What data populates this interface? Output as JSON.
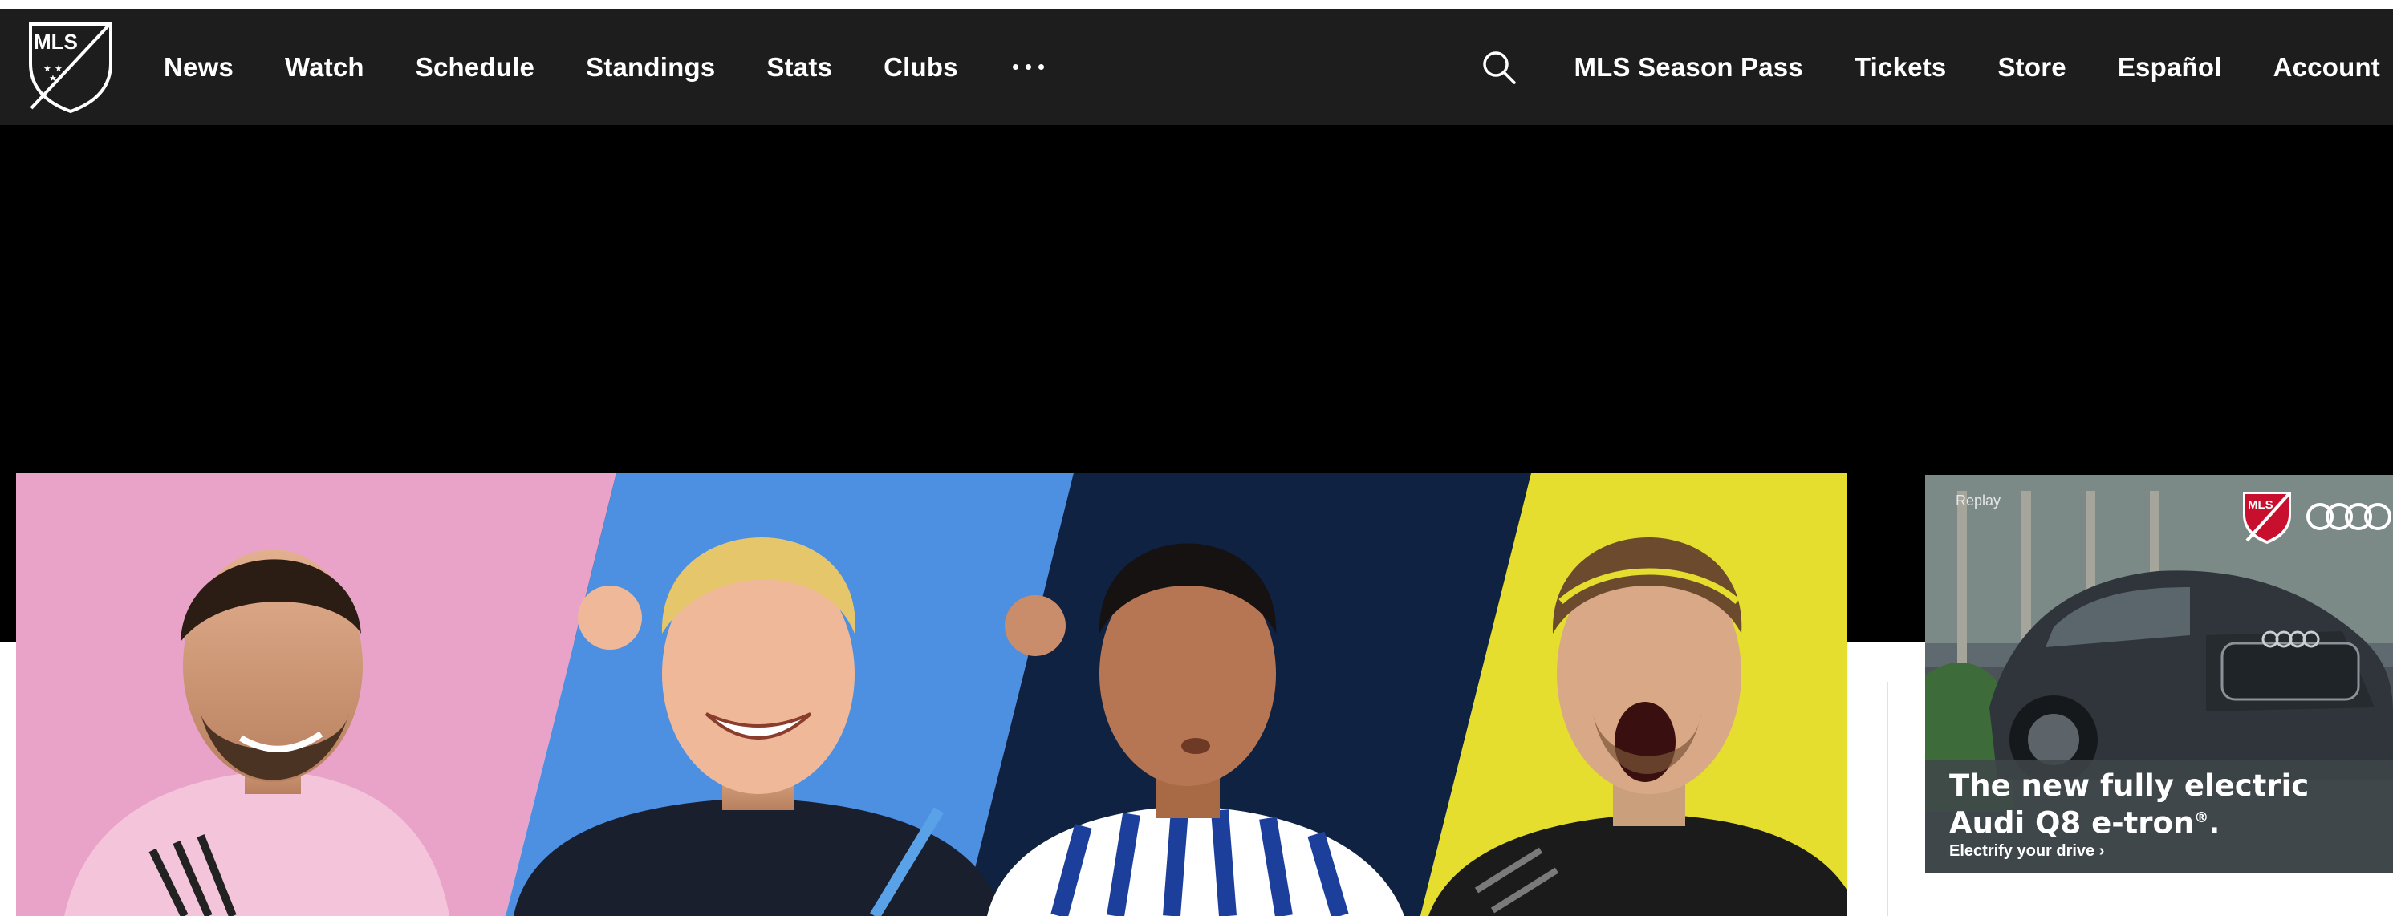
{
  "colors": {
    "nav_background": "#1d1d1d",
    "hero_background": "#000000",
    "panel_pink": "#e9a3c9",
    "panel_blue": "#4d8fe0",
    "panel_navy": "#0f2242",
    "panel_yellow": "#e5de2e"
  },
  "header": {
    "logo_text": "MLS",
    "logo_icon": "mls-crest-logo",
    "nav_left": [
      "News",
      "Watch",
      "Schedule",
      "Standings",
      "Stats",
      "Clubs"
    ],
    "more_icon": "ellipsis-icon",
    "search_icon": "search-icon",
    "nav_right": [
      "MLS Season Pass",
      "Tickets",
      "Store",
      "Español",
      "Account"
    ]
  },
  "hero": {
    "panels": [
      "player-pink-panel",
      "player-blue-panel",
      "player-navy-panel",
      "player-yellow-panel"
    ]
  },
  "ad": {
    "replay_label": "Replay",
    "headline_line1": "The new fully electric",
    "headline_line2": "Audi Q8 e-tron",
    "headline_mark": "®",
    "headline_end": ".",
    "cta": "Electrify your drive ›",
    "brand_icon": "audi-rings-icon",
    "partner_logo": "mls-crest-logo"
  }
}
